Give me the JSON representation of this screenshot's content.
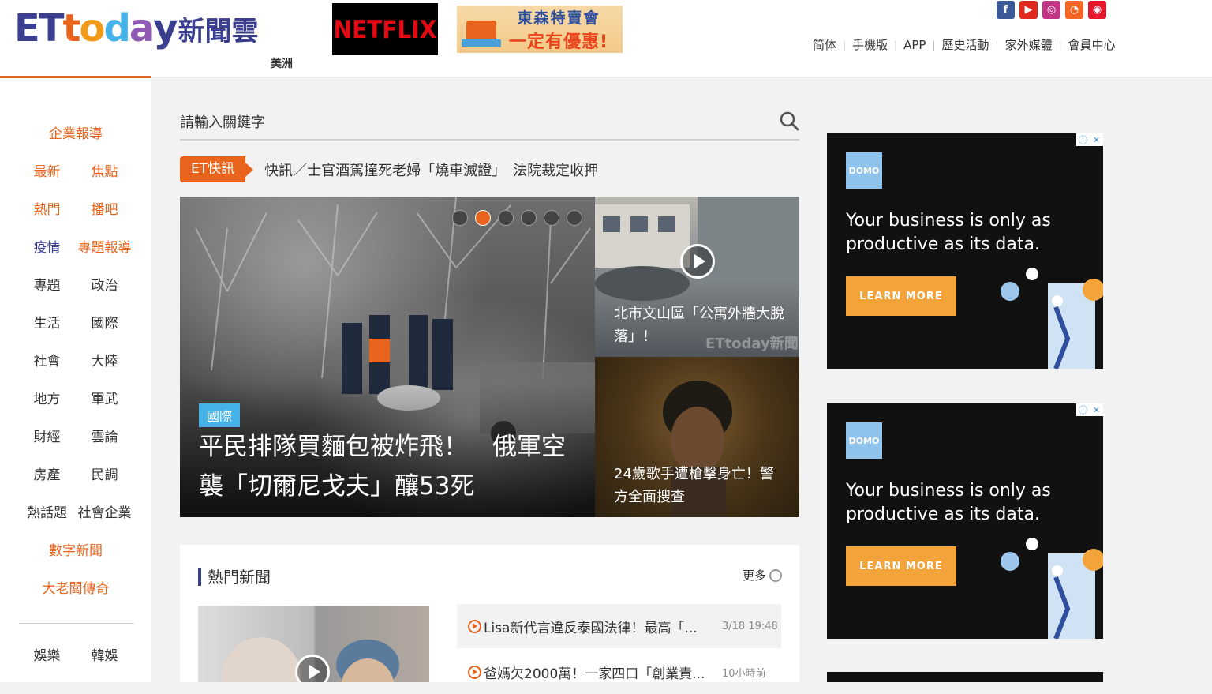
{
  "header": {
    "logo": {
      "e": "E",
      "t1": "T",
      "t2": "t",
      "o": "o",
      "d": "d",
      "a": "a",
      "y": "y",
      "cn": "新聞雲"
    },
    "region": "美洲",
    "netflix": "NETFLIX",
    "promo": {
      "line1": "東森特賣會",
      "line2": "一定有優惠!"
    },
    "social": [
      {
        "icon": "facebook-icon",
        "glyph": "f",
        "color": "#3b5998"
      },
      {
        "icon": "youtube-icon",
        "glyph": "▶",
        "color": "#e02a20"
      },
      {
        "icon": "instagram-icon",
        "glyph": "◎",
        "color": "#c13584"
      },
      {
        "icon": "rss-icon",
        "glyph": "◔",
        "color": "#f26522"
      },
      {
        "icon": "weibo-icon",
        "glyph": "◉",
        "color": "#e6162d"
      }
    ],
    "nav": [
      "简体",
      "手機版",
      "APP",
      "歷史活動",
      "家外媒體",
      "會員中心"
    ]
  },
  "sidebar": {
    "top": "企業報導",
    "rows": [
      [
        "最新",
        "焦點"
      ],
      [
        "熱門",
        "播吧"
      ],
      [
        "疫情",
        "專題報導"
      ],
      [
        "專題",
        "政治"
      ],
      [
        "生活",
        "國際"
      ],
      [
        "社會",
        "大陸"
      ],
      [
        "地方",
        "軍武"
      ],
      [
        "財經",
        "雲論"
      ],
      [
        "房產",
        "民調"
      ],
      [
        "熱話題",
        "社會企業"
      ]
    ],
    "bottom": [
      "數字新聞",
      "大老闆傳奇"
    ],
    "after_divider": [
      "娛樂",
      "韓娛"
    ]
  },
  "search": {
    "placeholder": "請輸入關鍵字"
  },
  "flash": {
    "badge": "ET快訊",
    "text": "快訊／士官酒駕撞死老婦「燒車滅證」　法院裁定收押"
  },
  "hero": {
    "tag": "國際",
    "title": "平民排隊買麵包被炸飛！　俄軍空襲「切爾尼戈夫」釀53死",
    "slides": 6,
    "active_slide": 2
  },
  "side_stories": [
    {
      "caption": "北市文山區「公寓外牆大脫落」！",
      "watermark": "ETtoday新聞"
    },
    {
      "caption": "24歲歌手遭槍擊身亡！警方全面搜查"
    }
  ],
  "hot": {
    "title": "熱門新聞",
    "more": "更多",
    "items": [
      {
        "title": "Lisa新代言違反泰國法律！最高「...",
        "time": "3/18 19:48"
      },
      {
        "title": "爸媽欠2000萬！一家四口「創業責...",
        "time": "10小時前"
      }
    ]
  },
  "ads": [
    {
      "logo": "DOMO",
      "copy": "Your business is only as productive as its data.",
      "cta": "LEARN MORE"
    },
    {
      "logo": "DOMO",
      "copy": "Your business is only as productive as its data.",
      "cta": "LEARN MORE"
    }
  ]
}
